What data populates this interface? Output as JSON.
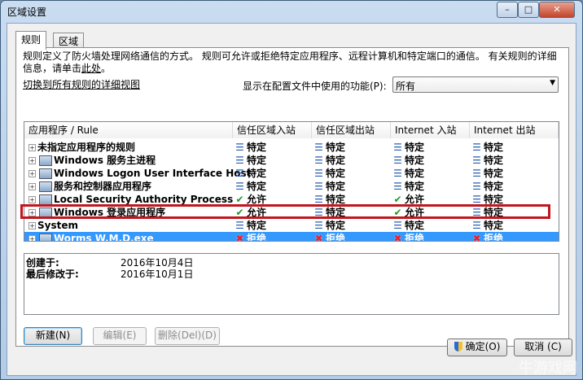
{
  "window": {
    "title": "区域设置",
    "controls": {
      "minimize": "–",
      "maximize": "□",
      "close": "✕"
    }
  },
  "tabs": [
    {
      "label": "规则",
      "active": true
    },
    {
      "label": "区域",
      "active": false
    }
  ],
  "description": {
    "text": "规则定义了防火墙处理网络通信的方式。 规则可允许或拒绝特定应用程序、远程计算机和特定端口的通信。 有关规则的详细信息，请单击",
    "link": "此处",
    "end": "。"
  },
  "detail_link": "切换到所有规则的详细视图",
  "filter": {
    "label": "显示在配置文件中使用的功能(P):",
    "value": "所有"
  },
  "columns": [
    "应用程序 / Rule",
    "信任区域入站",
    "信任区域出站",
    "Internet 入站",
    "Internet 出站"
  ],
  "rows": [
    {
      "name": "未指定应用程序的规则",
      "has_icon": false,
      "status": [
        [
          "specific",
          "特定"
        ],
        [
          "specific",
          "特定"
        ],
        [
          "specific",
          "特定"
        ],
        [
          "specific",
          "特定"
        ]
      ]
    },
    {
      "name": "Windows 服务主进程",
      "has_icon": true,
      "status": [
        [
          "specific",
          "特定"
        ],
        [
          "specific",
          "特定"
        ],
        [
          "specific",
          "特定"
        ],
        [
          "specific",
          "特定"
        ]
      ]
    },
    {
      "name": "Windows Logon User Interface Host",
      "has_icon": true,
      "status": [
        [
          "specific",
          "特定"
        ],
        [
          "specific",
          "特定"
        ],
        [
          "specific",
          "特定"
        ],
        [
          "specific",
          "特定"
        ]
      ]
    },
    {
      "name": "服务和控制器应用程序",
      "has_icon": true,
      "status": [
        [
          "specific",
          "特定"
        ],
        [
          "specific",
          "特定"
        ],
        [
          "specific",
          "特定"
        ],
        [
          "specific",
          "特定"
        ]
      ]
    },
    {
      "name": "Local Security Authority Process",
      "has_icon": true,
      "status": [
        [
          "allow",
          "允许"
        ],
        [
          "specific",
          "特定"
        ],
        [
          "allow",
          "允许"
        ],
        [
          "specific",
          "特定"
        ]
      ]
    },
    {
      "name": "Windows 登录应用程序",
      "has_icon": true,
      "status": [
        [
          "allow",
          "允许"
        ],
        [
          "specific",
          "特定"
        ],
        [
          "allow",
          "允许"
        ],
        [
          "specific",
          "特定"
        ]
      ]
    },
    {
      "name": "System",
      "has_icon": false,
      "status": [
        [
          "specific",
          "特定"
        ],
        [
          "specific",
          "特定"
        ],
        [
          "specific",
          "特定"
        ],
        [
          "specific",
          "特定"
        ]
      ]
    },
    {
      "name": "Worms W.M.D.exe",
      "has_icon": true,
      "selected": true,
      "status": [
        [
          "deny",
          "拒绝"
        ],
        [
          "deny",
          "拒绝"
        ],
        [
          "deny",
          "拒绝"
        ],
        [
          "deny",
          "拒绝"
        ]
      ]
    }
  ],
  "details": {
    "created_label": "创建于:",
    "created_value": "2016年10月4日",
    "modified_label": "最后修改于:",
    "modified_value": "2016年10月1日"
  },
  "buttons": {
    "new": "新建(N)",
    "edit": "编辑(E)",
    "delete": "删除(Del)(D)",
    "ok": "确定(O)",
    "cancel": "取消 (C)"
  },
  "watermark": "牛游戏网",
  "icons": {
    "specific": "lines-icon",
    "allow": "check-icon",
    "deny": "x-icon"
  },
  "colors": {
    "selection": "#3399ff",
    "highlight_box": "#c0161d",
    "allow": "#1e9c2c",
    "deny": "#d3262b",
    "specific": "#2a5db0"
  }
}
